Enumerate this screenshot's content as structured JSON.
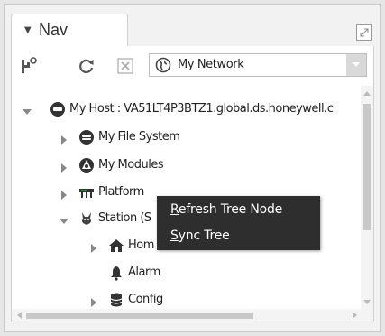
{
  "tab": {
    "title": "Nav",
    "caret_icon": "caret-down-icon"
  },
  "toolbar": {
    "dropdown_value": "My Network",
    "icons": [
      "nav-config-icon",
      "refresh-icon",
      "close-icon",
      "globe-icon"
    ]
  },
  "tree": {
    "rows": [
      {
        "label": "My Host : VA51LT4P3BTZ1.global.ds.honeywell.c",
        "icon": "host-icon",
        "expander": "expanded"
      },
      {
        "label": "My File System",
        "icon": "file-system-icon",
        "expander": "collapsed"
      },
      {
        "label": "My Modules",
        "icon": "modules-icon",
        "expander": "collapsed"
      },
      {
        "label": "Platform",
        "icon": "platform-icon",
        "expander": "collapsed"
      },
      {
        "label": "Station (S",
        "icon": "station-icon",
        "expander": "expanded"
      },
      {
        "label": "Hom",
        "icon": "home-icon",
        "expander": "collapsed"
      },
      {
        "label": "Alarm",
        "icon": "alarm-icon",
        "expander": "none"
      },
      {
        "label": "Config",
        "icon": "config-icon",
        "expander": "collapsed"
      }
    ]
  },
  "context_menu": {
    "items": [
      {
        "mnemonic": "R",
        "rest": "efresh Tree Node"
      },
      {
        "mnemonic": "S",
        "rest": "ync Tree"
      }
    ]
  },
  "colors": {
    "menu_bg": "#2e2e2e",
    "accent_green": "#2e8b2e"
  }
}
